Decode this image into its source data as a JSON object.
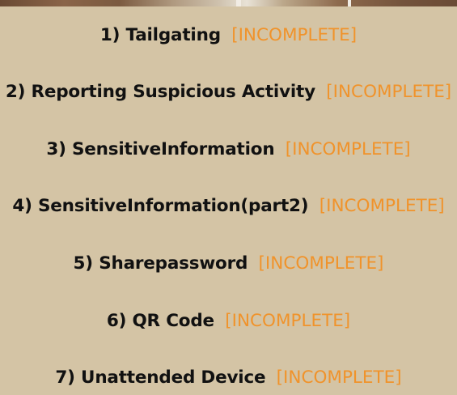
{
  "colors": {
    "background": "#d4c4a5",
    "task_text": "#111111",
    "incomplete_status": "#f0932b"
  },
  "quest_log": {
    "tasks": [
      {
        "label": "1) Tailgating",
        "status": "[INCOMPLETE]"
      },
      {
        "label": "2) Reporting Suspicious Activity",
        "status": "[INCOMPLETE]"
      },
      {
        "label": "3) SensitiveInformation",
        "status": "[INCOMPLETE]"
      },
      {
        "label": "4) SensitiveInformation(part2)",
        "status": "[INCOMPLETE]"
      },
      {
        "label": "5) Sharepassword",
        "status": "[INCOMPLETE]"
      },
      {
        "label": "6) QR Code",
        "status": "[INCOMPLETE]"
      },
      {
        "label": "7) Unattended Device",
        "status": "[INCOMPLETE]"
      }
    ]
  }
}
